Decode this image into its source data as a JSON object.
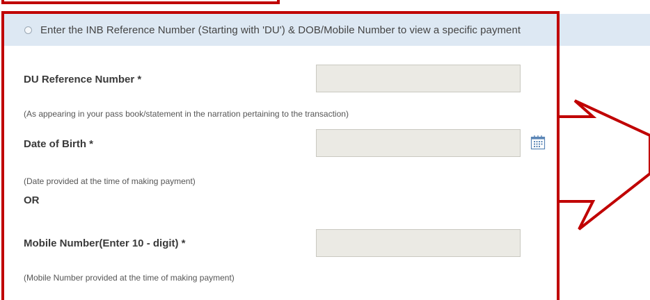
{
  "info_bar": {
    "text": "Enter the INB Reference Number (Starting with 'DU') & DOB/Mobile Number to view a specific payment"
  },
  "form": {
    "du_reference": {
      "label": "DU Reference Number *",
      "help": "(As appearing in your pass book/statement in the narration pertaining to the transaction)",
      "value": ""
    },
    "dob": {
      "label": "Date of Birth *",
      "help": "(Date provided at the time of making payment)",
      "value": ""
    },
    "or_text": "OR",
    "mobile": {
      "label": "Mobile Number(Enter 10 - digit) *",
      "help": "(Mobile Number provided at the time of making payment)",
      "value": ""
    }
  },
  "icons": {
    "radio": "radio-button-icon",
    "calendar": "calendar-icon",
    "arrow": "callout-arrow-icon"
  },
  "colors": {
    "annotation_red": "#c00000",
    "info_bar_bg": "#dde8f3",
    "field_bg": "#ebeae4"
  }
}
